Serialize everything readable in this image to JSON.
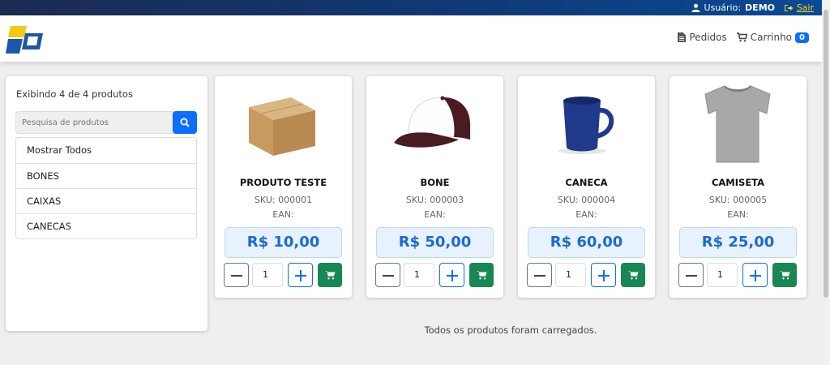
{
  "topbar": {
    "user_label": "Usuário:",
    "user_name": "DEMO",
    "logout_label": "Sair"
  },
  "nav": {
    "orders_label": "Pedidos",
    "cart_label": "Carrinho",
    "cart_count": "0"
  },
  "sidebar": {
    "showing_text": "Exibindo 4 de 4 produtos",
    "search_placeholder": "Pesquisa de produtos",
    "categories": [
      "Mostrar Todos",
      "BONES",
      "CAIXAS",
      "CANECAS"
    ]
  },
  "products": [
    {
      "name": "PRODUTO TESTE",
      "sku": "SKU: 000001",
      "ean": "EAN:",
      "price": "R$ 10,00",
      "qty": "1",
      "image": "box"
    },
    {
      "name": "BONE",
      "sku": "SKU: 000003",
      "ean": "EAN:",
      "price": "R$ 50,00",
      "qty": "1",
      "image": "cap"
    },
    {
      "name": "CANECA",
      "sku": "SKU: 000004",
      "ean": "EAN:",
      "price": "R$ 60,00",
      "qty": "1",
      "image": "mug"
    },
    {
      "name": "CAMISETA",
      "sku": "SKU: 000005",
      "ean": "EAN:",
      "price": "R$ 25,00",
      "qty": "1",
      "image": "tshirt"
    }
  ],
  "footer": {
    "loaded_text": "Todos os produtos foram carregados."
  },
  "colors": {
    "primary": "#0d6efd",
    "success": "#198754",
    "topbar": "#0f3a78",
    "accent_yellow": "#f7d21b",
    "price_text": "#1b6ad6"
  }
}
